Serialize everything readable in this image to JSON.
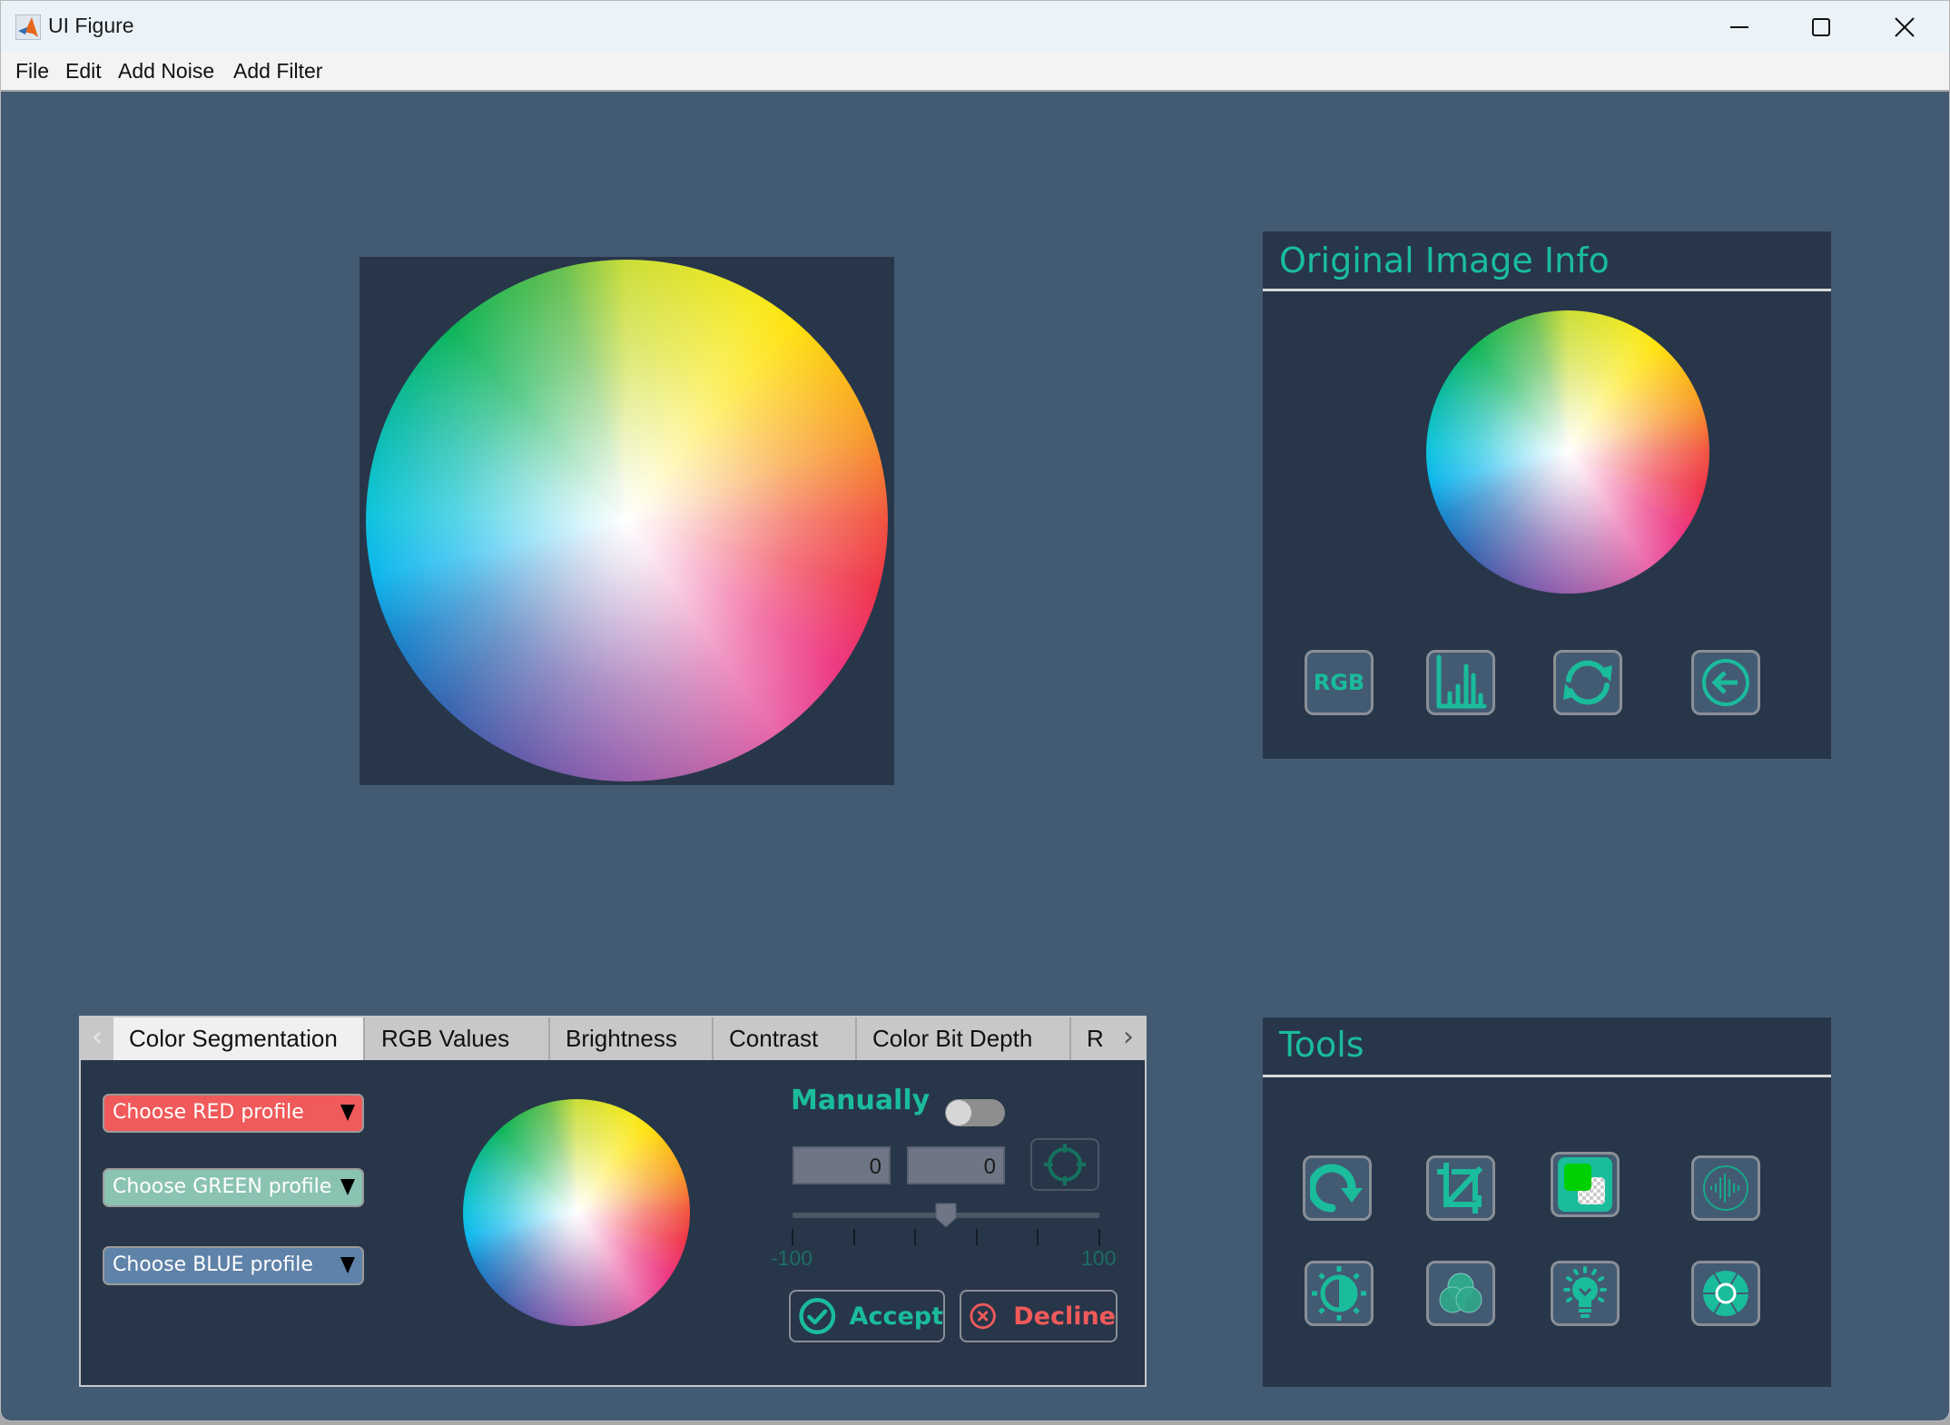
{
  "window": {
    "title": "UI Figure",
    "controls": [
      "minimize",
      "maximize",
      "close"
    ]
  },
  "menubar": {
    "items": [
      {
        "label": "File"
      },
      {
        "label": "Edit"
      },
      {
        "label": "Add Noise"
      },
      {
        "label": "Add Filter"
      }
    ]
  },
  "main_image": {
    "description": "color-wheel image"
  },
  "original_info": {
    "title": "Original Image Info",
    "buttons": [
      {
        "label": "RGB",
        "icon": "rgb-text-icon"
      },
      {
        "label": "",
        "icon": "histogram-icon"
      },
      {
        "label": "",
        "icon": "refresh-icon"
      },
      {
        "label": "",
        "icon": "back-arrow-icon"
      }
    ]
  },
  "tools": {
    "title": "Tools",
    "buttons": [
      {
        "icon": "rotate-icon"
      },
      {
        "icon": "crop-icon"
      },
      {
        "icon": "remove-background-icon"
      },
      {
        "icon": "noise-wave-icon"
      },
      {
        "icon": "brightness-contrast-icon"
      },
      {
        "icon": "color-channels-icon"
      },
      {
        "icon": "lightbulb-icon"
      },
      {
        "icon": "color-wheel-icon"
      }
    ]
  },
  "tabs": {
    "items": [
      {
        "label": "Color Segmentation",
        "active": true
      },
      {
        "label": "RGB Values",
        "active": false
      },
      {
        "label": "Brightness",
        "active": false
      },
      {
        "label": "Contrast",
        "active": false
      },
      {
        "label": "Color Bit Depth",
        "active": false
      },
      {
        "label": "R",
        "active": false
      }
    ]
  },
  "segmentation": {
    "red_dropdown": "Choose RED profile",
    "green_dropdown": "Choose GREEN profile",
    "blue_dropdown": "Choose BLUE profile",
    "manual_label": "Manually",
    "manual_toggle_on": false,
    "field1": "0",
    "field2": "0",
    "slider": {
      "min": -100,
      "max": 100,
      "value": 0,
      "min_label": "-100",
      "max_label": "100"
    },
    "accept_label": "Accept",
    "decline_label": "Decline"
  },
  "colors": {
    "accent": "#1abc9c",
    "background": "#435a73",
    "panel": "#28364a",
    "red": "#f05a5a",
    "green_dd": "#8bc3b3",
    "blue_dd": "#5f82a8"
  }
}
